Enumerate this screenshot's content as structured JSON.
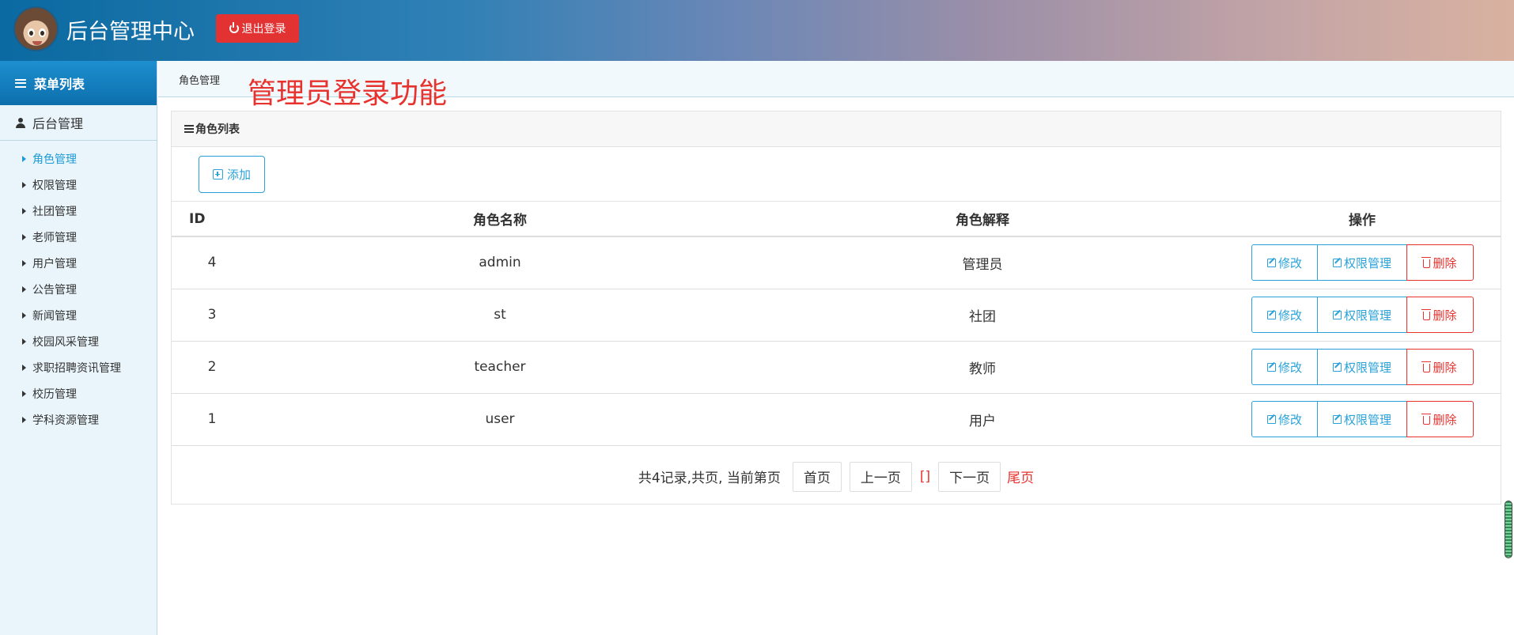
{
  "header": {
    "title": "后台管理中心",
    "logout_label": "退出登录"
  },
  "sidebar": {
    "menu_title": "菜单列表",
    "group_title": "后台管理",
    "items": [
      {
        "label": "角色管理",
        "active": true
      },
      {
        "label": "权限管理"
      },
      {
        "label": "社团管理"
      },
      {
        "label": "老师管理"
      },
      {
        "label": "用户管理"
      },
      {
        "label": "公告管理"
      },
      {
        "label": "新闻管理"
      },
      {
        "label": "校园风采管理"
      },
      {
        "label": "求职招聘资讯管理"
      },
      {
        "label": "校历管理"
      },
      {
        "label": "学科资源管理"
      }
    ]
  },
  "main": {
    "breadcrumb": "角色管理",
    "overlay_title": "管理员登录功能",
    "panel_title": "角色列表",
    "add_label": "添加",
    "table": {
      "columns": [
        "ID",
        "角色名称",
        "角色解释",
        "操作"
      ],
      "rows": [
        {
          "id": "4",
          "name": "admin",
          "desc": "管理员"
        },
        {
          "id": "3",
          "name": "st",
          "desc": "社团"
        },
        {
          "id": "2",
          "name": "teacher",
          "desc": "教师"
        },
        {
          "id": "1",
          "name": "user",
          "desc": "用户"
        }
      ],
      "actions": {
        "edit": "修改",
        "perm": "权限管理",
        "delete": "删除"
      }
    },
    "pager": {
      "info": "共4记录,共页, 当前第页",
      "first": "首页",
      "prev": "上一页",
      "current": "[]",
      "next": "下一页",
      "last": "尾页"
    }
  },
  "colors": {
    "accent": "#2aa2d8",
    "danger": "#e8322e",
    "sidebar_bg": "#e9f5fb"
  }
}
